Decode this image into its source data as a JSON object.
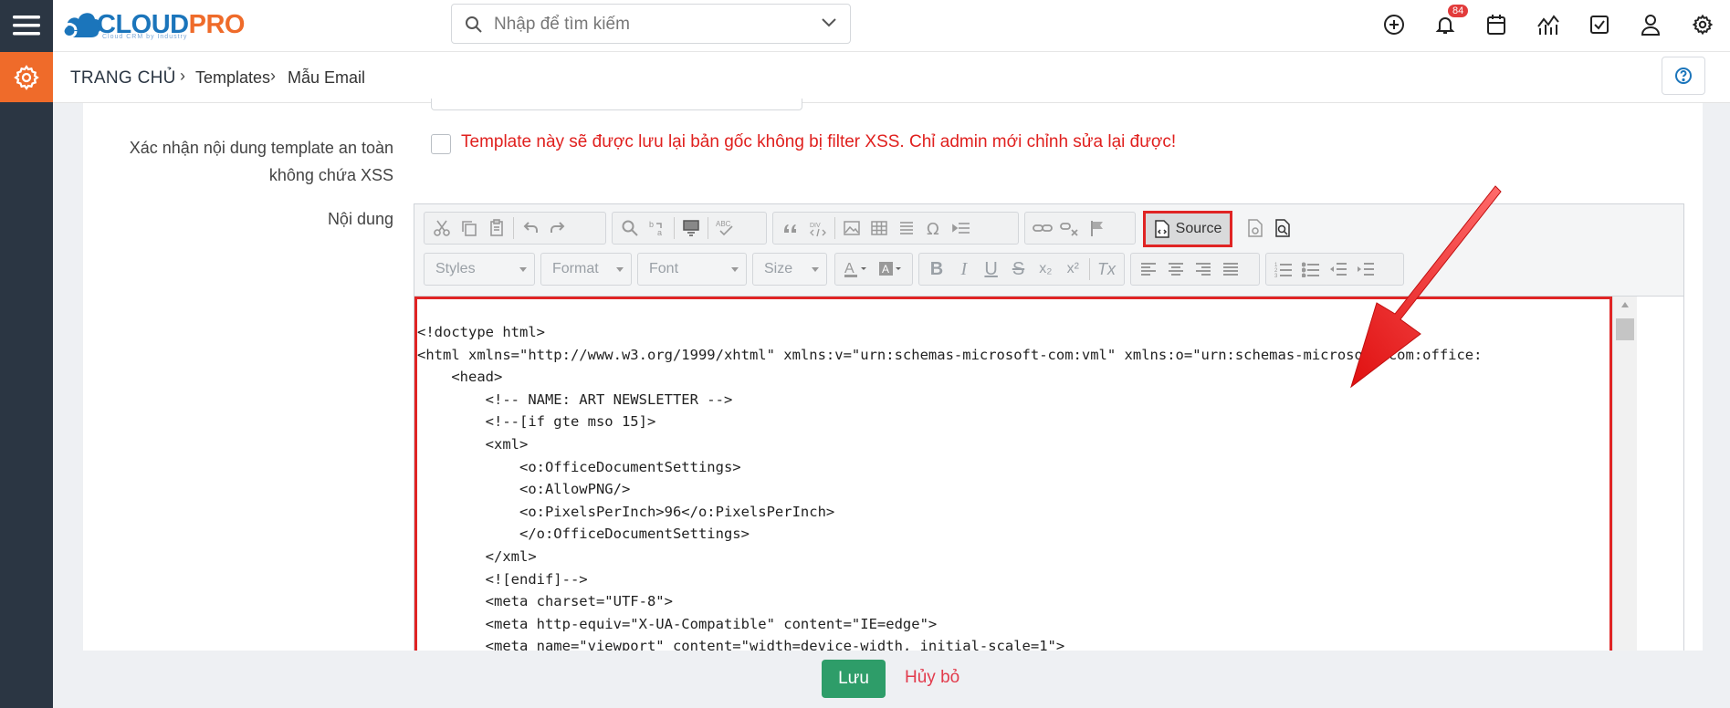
{
  "app": {
    "logo_text_1": "CLOUD",
    "logo_text_2": "PRO",
    "logo_tagline": "Cloud CRM by Industry"
  },
  "search": {
    "placeholder": "Nhập để tìm kiếm"
  },
  "header_icons": [
    "plus-circle-icon",
    "bell-icon",
    "calendar-icon",
    "chart-icon",
    "checkbox-icon",
    "user-icon",
    "settings-icon"
  ],
  "notifications": {
    "count": "84"
  },
  "breadcrumb": {
    "home": "TRANG CHỦ",
    "sep": "›",
    "items": [
      "Templates",
      "Mẫu Email"
    ]
  },
  "form": {
    "xss_label": "Xác nhận nội dung template an toàn không chứa XSS",
    "xss_note": "Template này sẽ được lưu lại bản gốc không bị filter XSS. Chỉ admin mới chỉnh sửa lại được!",
    "content_label": "Nội dung"
  },
  "editor": {
    "source_label": "Source",
    "combos": [
      "Styles",
      "Format",
      "Font",
      "Size"
    ],
    "format_buttons": [
      "B",
      "I",
      "U",
      "S",
      "x₂",
      "x²",
      "Tx"
    ],
    "code_lines": [
      "<!doctype html>",
      "<html xmlns=\"http://www.w3.org/1999/xhtml\" xmlns:v=\"urn:schemas-microsoft-com:vml\" xmlns:o=\"urn:schemas-microsoft-com:office:",
      "    <head>",
      "        <!-- NAME: ART NEWSLETTER -->",
      "        <!--[if gte mso 15]>",
      "        <xml>",
      "            <o:OfficeDocumentSettings>",
      "            <o:AllowPNG/>",
      "            <o:PixelsPerInch>96</o:PixelsPerInch>",
      "            </o:OfficeDocumentSettings>",
      "        </xml>",
      "        <![endif]-->",
      "        <meta charset=\"UTF-8\">",
      "        <meta http-equiv=\"X-UA-Compatible\" content=\"IE=edge\">",
      "        <meta name=\"viewport\" content=\"width=device-width, initial-scale=1\">"
    ]
  },
  "footer": {
    "save_label": "Lưu",
    "cancel_label": "Hủy bỏ"
  },
  "colors": {
    "rail": "#2b3643",
    "accent_orange": "#ef6b2a",
    "highlight_red": "#e02424",
    "save_green": "#2e9d69"
  }
}
